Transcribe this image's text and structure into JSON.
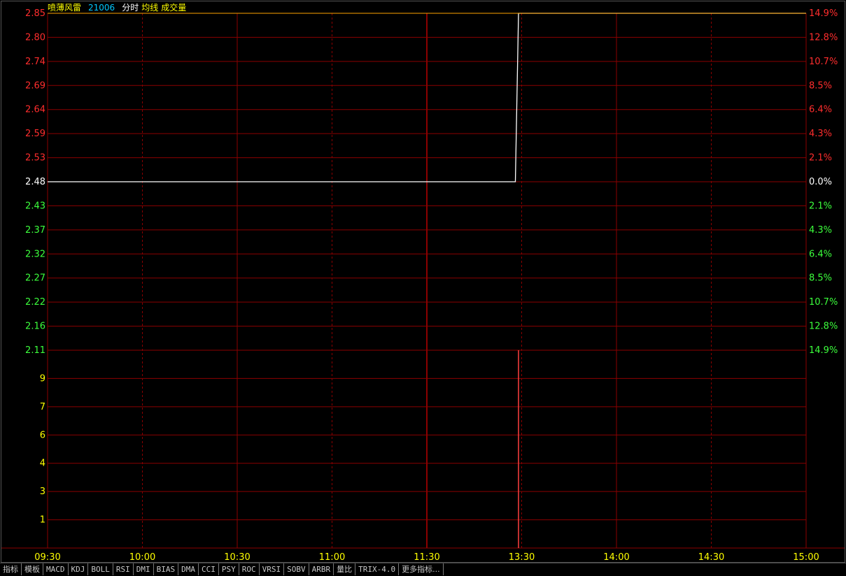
{
  "header": {
    "stock_name": "喷薄风雷",
    "code": "21006",
    "mode": "分时",
    "avg_label": "均线",
    "volume_label": "成交量"
  },
  "colors": {
    "background": "#000000",
    "grid": "#8b0000",
    "up": "#ff2d2d",
    "down": "#3cff3c",
    "neutral": "#ffffff",
    "axis_time": "#ffff00",
    "volume_axis": "#ffff00",
    "price_line": "#ffffff",
    "avg_line": "#ffff00",
    "volume_bar": "#ff4040"
  },
  "chart_data": [
    {
      "type": "line",
      "panel": "price",
      "prev_close": 2.48,
      "ylim": [
        2.11,
        2.85
      ],
      "y_ticks": [
        "2.85",
        "2.80",
        "2.74",
        "2.69",
        "2.64",
        "2.59",
        "2.53",
        "2.48",
        "2.43",
        "2.37",
        "2.32",
        "2.27",
        "2.22",
        "2.16",
        "2.11"
      ],
      "y_ticks_right": [
        "14.9%",
        "12.8%",
        "10.7%",
        "8.5%",
        "6.4%",
        "4.3%",
        "2.1%",
        "0.0%",
        "2.1%",
        "4.3%",
        "6.4%",
        "8.5%",
        "10.7%",
        "12.8%",
        "14.9%"
      ],
      "x_range_minutes": [
        0,
        240
      ],
      "x_ticks": [
        "09:30",
        "10:00",
        "10:30",
        "11:00",
        "11:30",
        "13:30",
        "14:00",
        "14:30",
        "15:00"
      ],
      "series": [
        {
          "points": [
            [
              0,
              2.48
            ],
            [
              148,
              2.48
            ],
            [
              149,
              2.85
            ],
            [
              240,
              2.85
            ]
          ]
        }
      ],
      "grid": true
    },
    {
      "type": "bar",
      "panel": "volume",
      "ylim": [
        0,
        10
      ],
      "y_ticks": [
        "9",
        "7",
        "6",
        "4",
        "3",
        "1"
      ],
      "bars": [
        [
          149,
          10
        ]
      ],
      "grid": true
    }
  ],
  "tabs": [
    "指标",
    "模板",
    "MACD",
    "KDJ",
    "BOLL",
    "RSI",
    "DMI",
    "BIAS",
    "DMA",
    "CCI",
    "PSY",
    "ROC",
    "VRSI",
    "SOBV",
    "ARBR",
    "量比",
    "TRIX-4.0",
    "更多指标..."
  ]
}
